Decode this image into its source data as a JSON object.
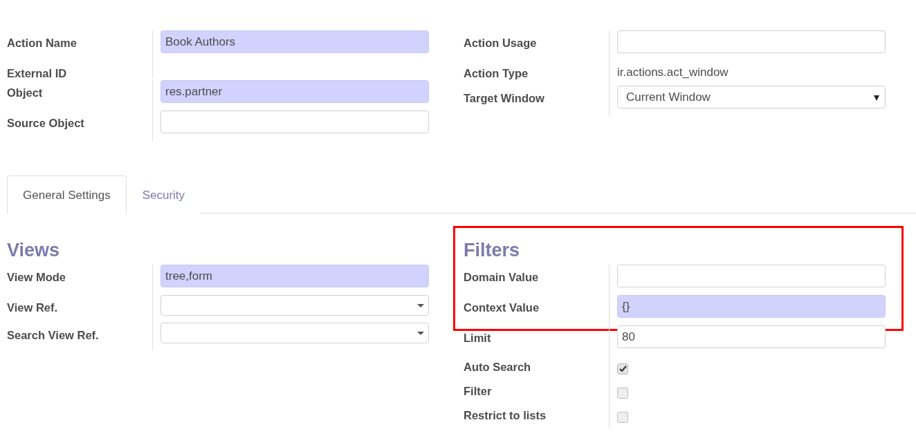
{
  "header": {
    "left": [
      {
        "kind": "input",
        "label": "Action Name",
        "value": "Book Authors",
        "required": true
      },
      {
        "kind": "none",
        "label": "External ID"
      },
      {
        "kind": "input",
        "label": "Object",
        "value": "res.partner",
        "required": true
      },
      {
        "kind": "input",
        "label": "Source Object",
        "required": false
      }
    ],
    "right": [
      {
        "kind": "input",
        "label": "Action Usage",
        "required": false
      },
      {
        "kind": "text",
        "label": "Action Type",
        "value": "ir.actions.act_window"
      },
      {
        "kind": "select",
        "label": "Target Window",
        "value": "Current Window",
        "required": false
      }
    ]
  },
  "tabs": [
    {
      "label": "General Settings",
      "selected": true
    },
    {
      "label": "Security",
      "selected": false
    }
  ],
  "sections": [
    {
      "title": "Views",
      "fields": [
        {
          "kind": "input",
          "label": "View Mode",
          "value": "tree,form",
          "required": true
        },
        {
          "kind": "combo",
          "label": "View Ref.",
          "required": false
        },
        {
          "kind": "combo",
          "label": "Search View Ref.",
          "required": false
        }
      ]
    },
    {
      "title": "Filters",
      "highlight": {
        "fields": [
          {
            "kind": "input",
            "label": "Domain Value",
            "required": false
          },
          {
            "kind": "input",
            "label": "Context Value",
            "value": "{}",
            "required": true
          }
        ]
      },
      "fields": [
        {
          "kind": "input",
          "label": "Limit",
          "value": "80",
          "required": false
        },
        {
          "kind": "checkbox",
          "label": "Auto Search",
          "checked": true
        },
        {
          "kind": "checkbox",
          "label": "Filter",
          "checked": false
        },
        {
          "kind": "checkbox",
          "label": "Restrict to lists",
          "checked": false
        }
      ]
    }
  ]
}
